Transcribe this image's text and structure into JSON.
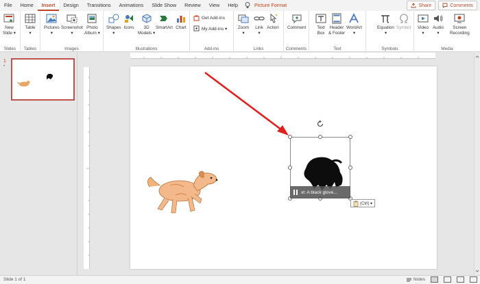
{
  "tabs": [
    {
      "label": "File",
      "state": "normal"
    },
    {
      "label": "Home",
      "state": "normal"
    },
    {
      "label": "Insert",
      "state": "active"
    },
    {
      "label": "Design",
      "state": "normal"
    },
    {
      "label": "Transitions",
      "state": "normal"
    },
    {
      "label": "Animations",
      "state": "normal"
    },
    {
      "label": "Slide Show",
      "state": "normal"
    },
    {
      "label": "Review",
      "state": "normal"
    },
    {
      "label": "View",
      "state": "normal"
    },
    {
      "label": "Help",
      "state": "normal"
    },
    {
      "label": "Picture Format",
      "state": "contextual"
    }
  ],
  "share_label": "Share",
  "comments_label": "Comments",
  "ribbon": {
    "slides": {
      "label": "Slides",
      "new_slide": "New\nSlide ▾"
    },
    "tables": {
      "label": "Tables",
      "table": "Table\n▾"
    },
    "images": {
      "label": "Images",
      "pictures": "Pictures\n▾",
      "screenshot": "Screenshot\n▾",
      "photo_album": "Photo\nAlbum ▾"
    },
    "illustrations": {
      "label": "Illustrations",
      "shapes": "Shapes\n▾",
      "icons": "Icons",
      "models": "3D\nModels ▾",
      "smartart": "SmartArt",
      "chart": "Chart"
    },
    "addins": {
      "label": "Add-ins",
      "get_addins": "Get Add-ins",
      "my_addins": "My Add-ins ▾"
    },
    "links": {
      "label": "Links",
      "zoom": "Zoom\n▾",
      "link": "Link\n▾",
      "action": "Action"
    },
    "comments": {
      "label": "Comments",
      "comment": "Comment"
    },
    "text": {
      "label": "Text",
      "textbox": "Text\nBox",
      "header_footer": "Header\n& Footer",
      "wordart": "WordArt\n▾"
    },
    "symbols": {
      "label": "Symbols",
      "equation": "Equation\n▾",
      "symbol": "Symbol"
    },
    "media": {
      "label": "Media",
      "video": "Video\n▾",
      "audio": "Audio\n▾",
      "screen_recording": "Screen\nRecording"
    }
  },
  "thumbnail": {
    "number": "1",
    "marker": "*"
  },
  "alt_text": "xt: A black glove...",
  "paste_options": "(Ctrl) ▾",
  "status": {
    "slide": "Slide 1 of 1",
    "notes": "Notes"
  },
  "colors": {
    "accent": "#b7472a",
    "arrow": "#e02020"
  }
}
